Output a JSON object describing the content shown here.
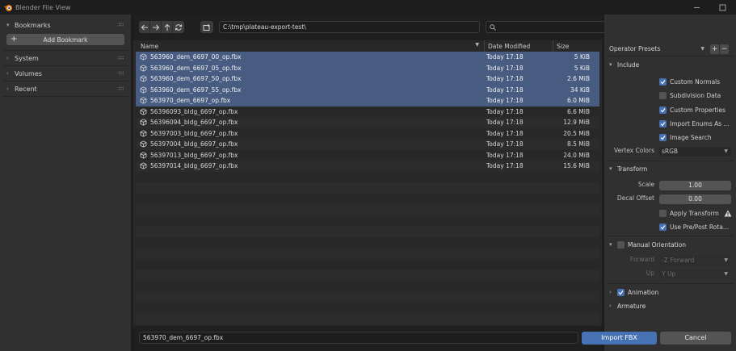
{
  "window": {
    "title": "Blender File View"
  },
  "sidebar": {
    "bookmarks_label": "Bookmarks",
    "add_bookmark_label": "Add Bookmark",
    "sections": [
      {
        "label": "System"
      },
      {
        "label": "Volumes"
      },
      {
        "label": "Recent"
      }
    ]
  },
  "toolbar": {
    "path": "C:\\tmp\\plateau-export-test\\",
    "search_value": ""
  },
  "columns": {
    "name": "Name",
    "date": "Date Modified",
    "size": "Size"
  },
  "files": [
    {
      "name": "563960_dem_6697_00_op.fbx",
      "date": "Today 17:18",
      "size": "5 KiB",
      "selected": true
    },
    {
      "name": "563960_dem_6697_05_op.fbx",
      "date": "Today 17:18",
      "size": "5 KiB",
      "selected": true
    },
    {
      "name": "563960_dem_6697_50_op.fbx",
      "date": "Today 17:18",
      "size": "2.6 MiB",
      "selected": true
    },
    {
      "name": "563960_dem_6697_55_op.fbx",
      "date": "Today 17:18",
      "size": "34 KiB",
      "selected": true
    },
    {
      "name": "563970_dem_6697_op.fbx",
      "date": "Today 17:18",
      "size": "6.0 MiB",
      "selected": true
    },
    {
      "name": "56396093_bldg_6697_op.fbx",
      "date": "Today 17:18",
      "size": "6.6 MiB",
      "selected": false
    },
    {
      "name": "56396094_bldg_6697_op.fbx",
      "date": "Today 17:18",
      "size": "12.9 MiB",
      "selected": false
    },
    {
      "name": "56397003_bldg_6697_op.fbx",
      "date": "Today 17:18",
      "size": "20.5 MiB",
      "selected": false
    },
    {
      "name": "56397004_bldg_6697_op.fbx",
      "date": "Today 17:18",
      "size": "8.5 MiB",
      "selected": false
    },
    {
      "name": "56397013_bldg_6697_op.fbx",
      "date": "Today 17:18",
      "size": "24.0 MiB",
      "selected": false
    },
    {
      "name": "56397014_bldg_6697_op.fbx",
      "date": "Today 17:18",
      "size": "15.6 MiB",
      "selected": false
    }
  ],
  "bottombar": {
    "filename": "563970_dem_6697_op.fbx"
  },
  "operator": {
    "presets_label": "Operator Presets",
    "include_label": "Include",
    "include_options": [
      {
        "label": "Custom Normals",
        "checked": true
      },
      {
        "label": "Subdivision Data",
        "checked": false
      },
      {
        "label": "Custom Properties",
        "checked": true
      },
      {
        "label": "Import Enums As ...",
        "checked": true
      },
      {
        "label": "Image Search",
        "checked": true
      }
    ],
    "vertex_colors_label": "Vertex Colors",
    "vertex_colors_value": "sRGB",
    "transform_label": "Transform",
    "scale_label": "Scale",
    "scale_value": "1.00",
    "decal_offset_label": "Decal Offset",
    "decal_offset_value": "0.00",
    "apply_transform_label": "Apply Transform",
    "apply_transform_checked": false,
    "use_prepost_label": "Use Pre/Post Rota...",
    "use_prepost_checked": true,
    "manual_orientation_label": "Manual Orientation",
    "manual_orientation_checked": false,
    "forward_label": "Forward",
    "forward_value": "-Z Forward",
    "up_label": "Up",
    "up_value": "Y Up",
    "animation_label": "Animation",
    "animation_checked": true,
    "armature_label": "Armature"
  },
  "actions": {
    "import_label": "Import FBX",
    "cancel_label": "Cancel"
  },
  "colors": {
    "accent": "#4772b3",
    "selected_row": "#485c82",
    "panel": "#303030",
    "list": "#282828"
  }
}
